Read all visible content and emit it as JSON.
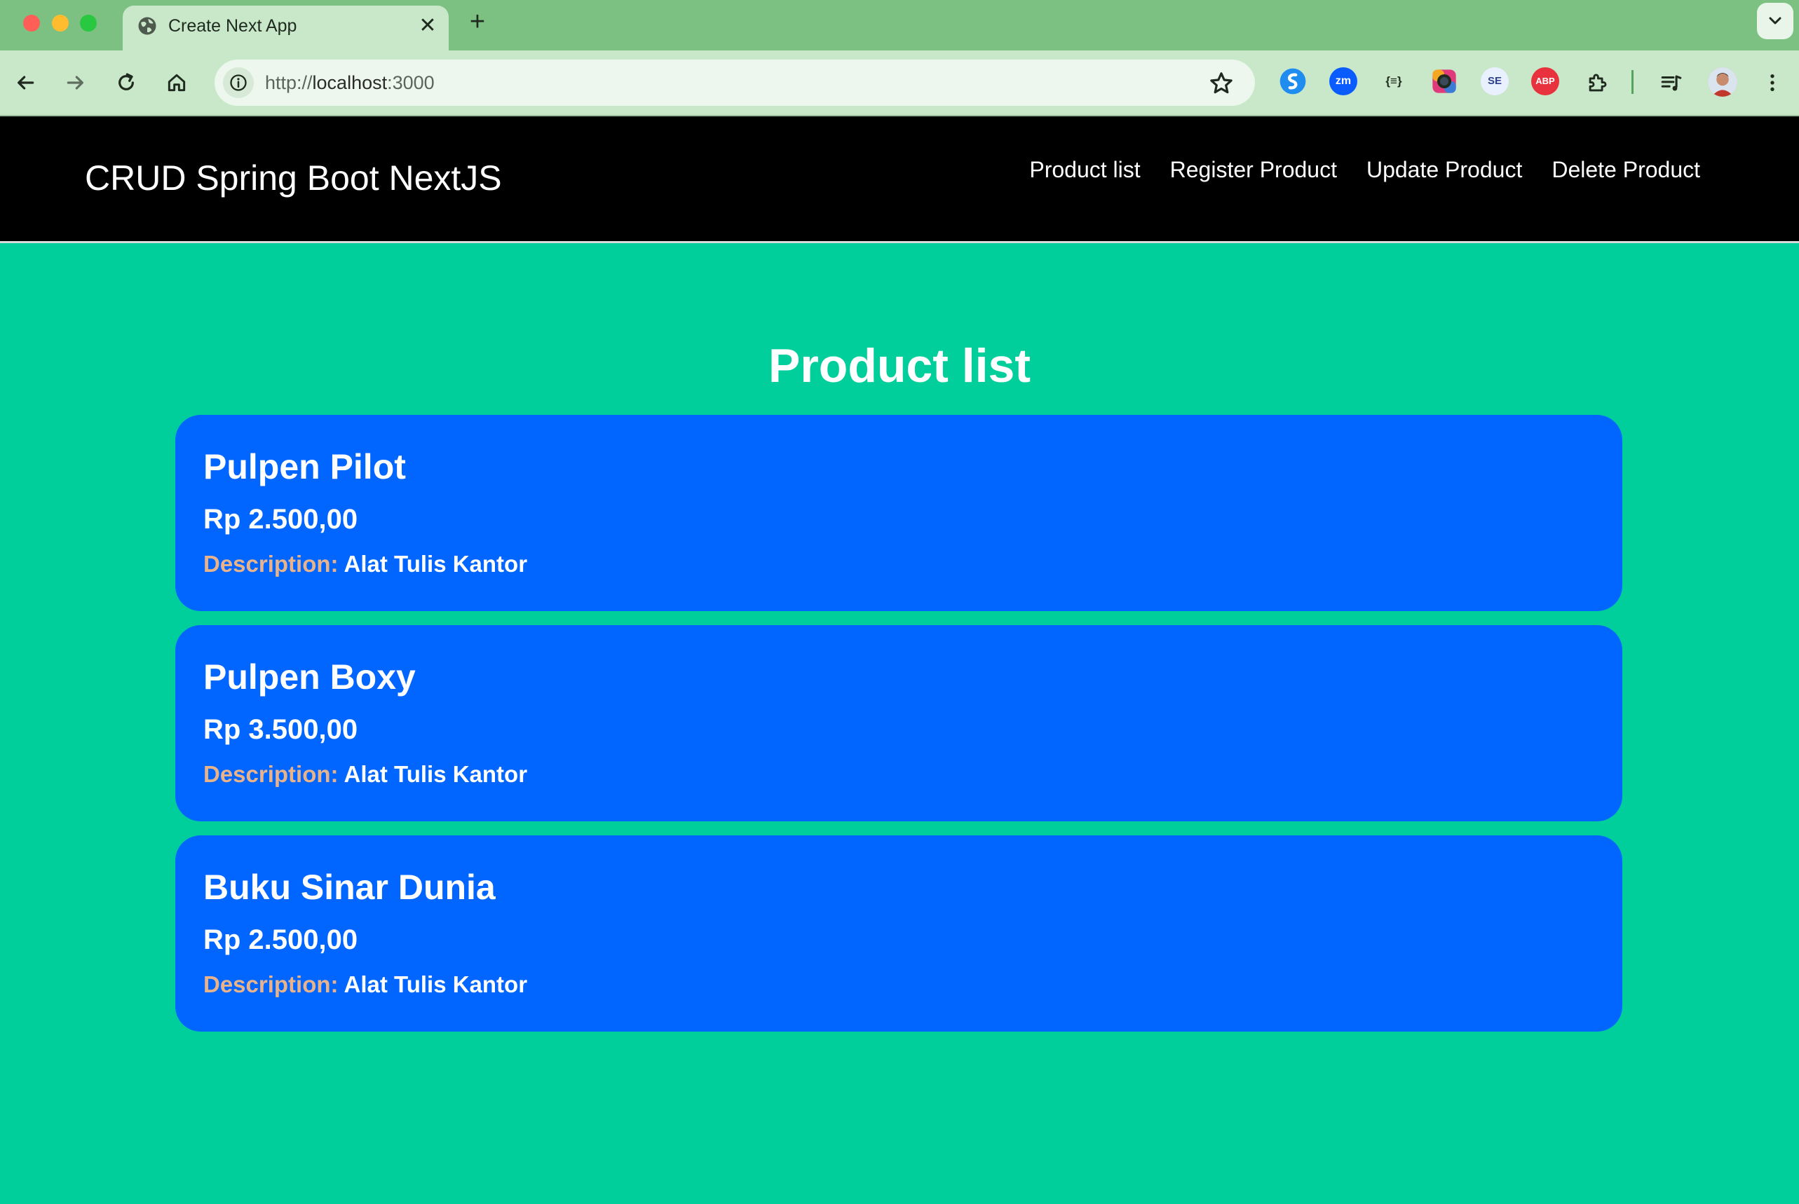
{
  "browser": {
    "tab": {
      "title": "Create Next App",
      "close_label": "✕",
      "globe_icon": "globe-icon"
    },
    "new_tab_label": "+",
    "url": {
      "scheme": "http://",
      "host": "localhost",
      "port": ":3000"
    },
    "extensions": [
      {
        "name": "shazam-extension-icon",
        "label": "S",
        "color": "#1f8cf0"
      },
      {
        "name": "zoom-extension-icon",
        "label": "zm",
        "color": "#0b5cff"
      },
      {
        "name": "json-formatter-extension-icon",
        "label": "{≡}",
        "color": "#c9e7c9"
      },
      {
        "name": "color-picker-extension-icon",
        "label": "●",
        "color": "#e03a7b"
      },
      {
        "name": "seo-extension-icon",
        "label": "SE",
        "color": "#2c3e8f"
      },
      {
        "name": "adblock-plus-extension-icon",
        "label": "ABP",
        "color": "#e8333f"
      }
    ]
  },
  "site": {
    "brand": "CRUD Spring Boot NextJS",
    "nav": [
      {
        "label": "Product list"
      },
      {
        "label": "Register Product"
      },
      {
        "label": "Update Product"
      },
      {
        "label": "Delete Product"
      }
    ],
    "page_title": "Product list",
    "products": [
      {
        "name": "Pulpen Pilot",
        "price": "Rp 2.500,00",
        "desc_label": "Description:",
        "description": "Alat Tulis Kantor"
      },
      {
        "name": "Pulpen Boxy",
        "price": "Rp 3.500,00",
        "desc_label": "Description:",
        "description": "Alat Tulis Kantor"
      },
      {
        "name": "Buku Sinar Dunia",
        "price": "Rp 2.500,00",
        "desc_label": "Description:",
        "description": "Alat Tulis Kantor"
      }
    ]
  },
  "colors": {
    "page_background": "#00cf9c",
    "card_background": "#0066ff",
    "header_background": "#000000",
    "description_label": "#e8b28a"
  }
}
